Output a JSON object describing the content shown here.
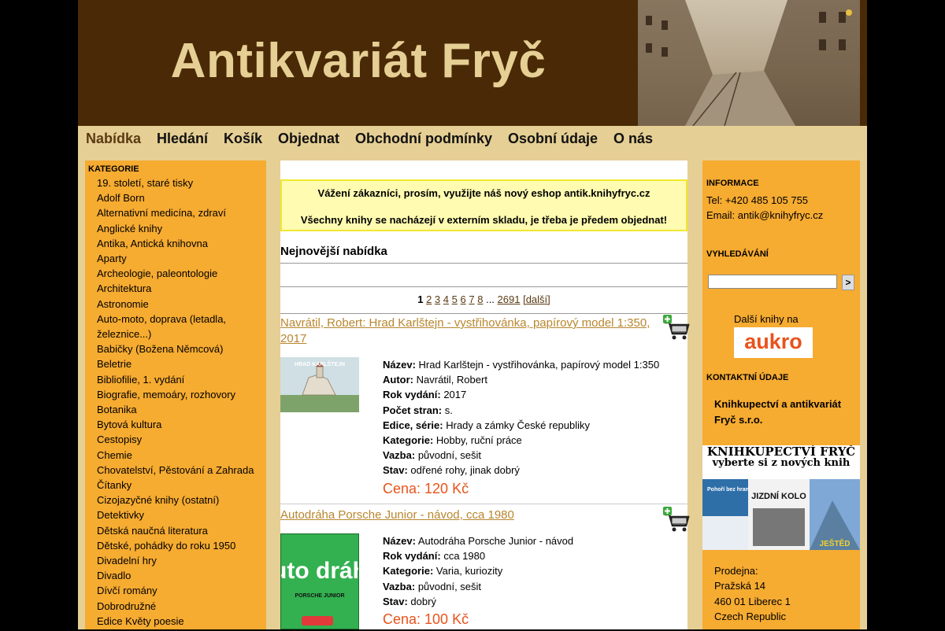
{
  "header": {
    "site_title": "Antikvariát Fryč"
  },
  "nav": {
    "items": [
      {
        "label": "Nabídka",
        "active": true
      },
      {
        "label": "Hledání"
      },
      {
        "label": "Košík"
      },
      {
        "label": "Objednat"
      },
      {
        "label": "Obchodní podmínky"
      },
      {
        "label": "Osobní údaje"
      },
      {
        "label": "O nás"
      }
    ]
  },
  "sidebar": {
    "heading": "KATEGORIE",
    "categories": [
      "19. století, staré tisky",
      "Adolf Born",
      "Alternativní medicína, zdraví",
      "Anglické knihy",
      "Antika, Antická knihovna",
      "Aparty",
      "Archeologie, paleontologie",
      "Architektura",
      "Astronomie",
      "Auto-moto, doprava (letadla, železnice...)",
      "Babičky (Božena Němcová)",
      "Beletrie",
      "Bibliofilie, 1. vydání",
      "Biografie, memoáry, rozhovory",
      "Botanika",
      "Bytová kultura",
      "Cestopisy",
      "Chemie",
      "Chovatelství, Pěstování a Zahrada",
      "Čítanky",
      "Cizojazyčné knihy (ostatní)",
      "Detektivky",
      "Dětská naučná literatura",
      "Dětské, pohádky do roku 1950",
      "Divadelní hry",
      "Divadlo",
      "Dívčí romány",
      "Dobrodružné",
      "Edice Květy poesie"
    ]
  },
  "notice": {
    "line1": "Vážení zákazníci, prosím, využijte náš nový eshop antik.knihyfryc.cz",
    "line2": "Všechny knihy se nacházejí v externím skladu, je třeba je předem objednat!"
  },
  "main": {
    "newest_title": "Nejnovější nabídka",
    "pager": {
      "current": "1",
      "pages": [
        "2",
        "3",
        "4",
        "5",
        "6",
        "7",
        "8"
      ],
      "ellipsis": "...",
      "last": "2691",
      "next": "[další]"
    },
    "books": [
      {
        "title": "Navrátil, Robert: Hrad Karlštejn - vystřihovánka, papírový model 1:350, 2017",
        "thumb_text": "HRAD KARLŠTEJN",
        "fields": [
          {
            "label": "Název:",
            "value": "Hrad Karlštejn - vystřihovánka, papírový model 1:350"
          },
          {
            "label": "Autor:",
            "value": "Navrátil, Robert"
          },
          {
            "label": "Rok vydání:",
            "value": "2017"
          },
          {
            "label": "Počet stran:",
            "value": "s."
          },
          {
            "label": "Edice, série:",
            "value": "Hrady a zámky České republiky"
          },
          {
            "label": "Kategorie:",
            "value": "Hobby, ruční práce"
          },
          {
            "label": "Vazba:",
            "value": "původní, sešit"
          },
          {
            "label": "Stav:",
            "value": "odřené rohy, jinak dobrý"
          }
        ],
        "price": "Cena: 120 Kč"
      },
      {
        "title": "Autodráha Porsche Junior - návod, cca 1980",
        "thumb_text": "auto dráha",
        "thumb_sub": "PORSCHE JUNIOR",
        "fields": [
          {
            "label": "Název:",
            "value": "Autodráha Porsche Junior - návod"
          },
          {
            "label": "Rok vydání:",
            "value": "cca 1980"
          },
          {
            "label": "Kategorie:",
            "value": "Varia, kuriozity"
          },
          {
            "label": "Vazba:",
            "value": "původní, sešit"
          },
          {
            "label": "Stav:",
            "value": "dobrý"
          }
        ],
        "price": "Cena: 100 Kč"
      }
    ]
  },
  "right": {
    "info_heading": "INFORMACE",
    "tel": "Tel: +420 485 105 755",
    "email": "Email: antik@knihyfryc.cz",
    "search_heading": "VYHLEDÁVÁNÍ",
    "search_button": ">",
    "search_value": "",
    "aukro_label": "Další knihy na",
    "aukro_logo": "aukro",
    "contact_heading": "KONTAKTNÍ ÚDAJE",
    "company_line1": "Knihkupectví a antikvariát",
    "company_line2": "Fryč s.r.o.",
    "promo_title": "KNIHKUPECTVÍ FRYČ",
    "promo_sub": "vyberte si z nových knih",
    "promo_books": [
      "Pohoří bez hranic",
      "JIZDNÍ KOLO",
      "JEŠTĚD"
    ],
    "shop_lines": [
      "Prodejna:",
      "Pražská 14",
      "460 01 Liberec 1",
      "Czech Republic"
    ]
  },
  "colors": {
    "banner_brown": "#4a2a06",
    "page_tan": "#e6cf94",
    "sidebar_orange": "#f6ab31",
    "link_gold": "#b8862e",
    "price_orange": "#e8531c"
  }
}
